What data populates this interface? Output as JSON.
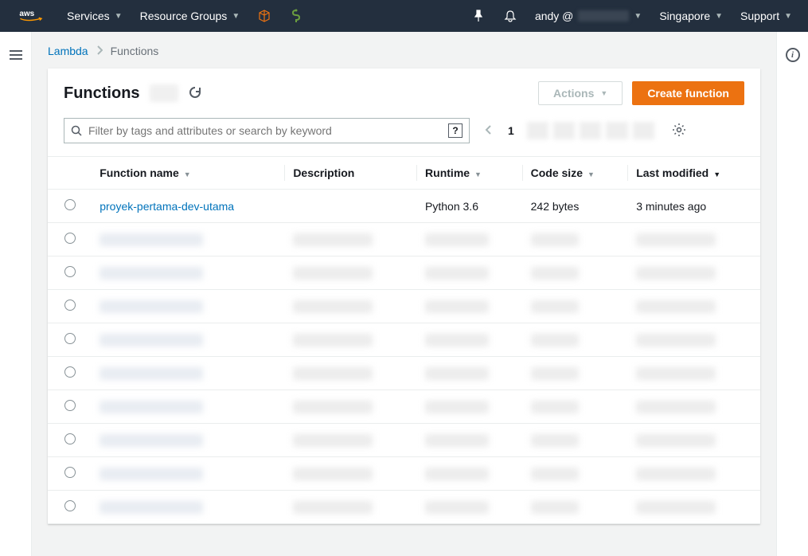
{
  "topnav": {
    "services": "Services",
    "resource_groups": "Resource Groups",
    "user_prefix": "andy @",
    "region": "Singapore",
    "support": "Support"
  },
  "breadcrumb": {
    "service": "Lambda",
    "page": "Functions"
  },
  "header": {
    "title": "Functions",
    "actions_label": "Actions",
    "create_label": "Create function"
  },
  "search": {
    "placeholder": "Filter by tags and attributes or search by keyword",
    "current_page": "1"
  },
  "columns": {
    "name": "Function name",
    "description": "Description",
    "runtime": "Runtime",
    "size": "Code size",
    "modified": "Last modified"
  },
  "rows": [
    {
      "name": "proyek-pertama-dev-utama",
      "description": "",
      "runtime": "Python 3.6",
      "size": "242 bytes",
      "modified": "3 minutes ago",
      "blurred": false
    },
    {
      "blurred": true
    },
    {
      "blurred": true
    },
    {
      "blurred": true
    },
    {
      "blurred": true
    },
    {
      "blurred": true
    },
    {
      "blurred": true
    },
    {
      "blurred": true
    },
    {
      "blurred": true
    },
    {
      "blurred": true
    }
  ]
}
